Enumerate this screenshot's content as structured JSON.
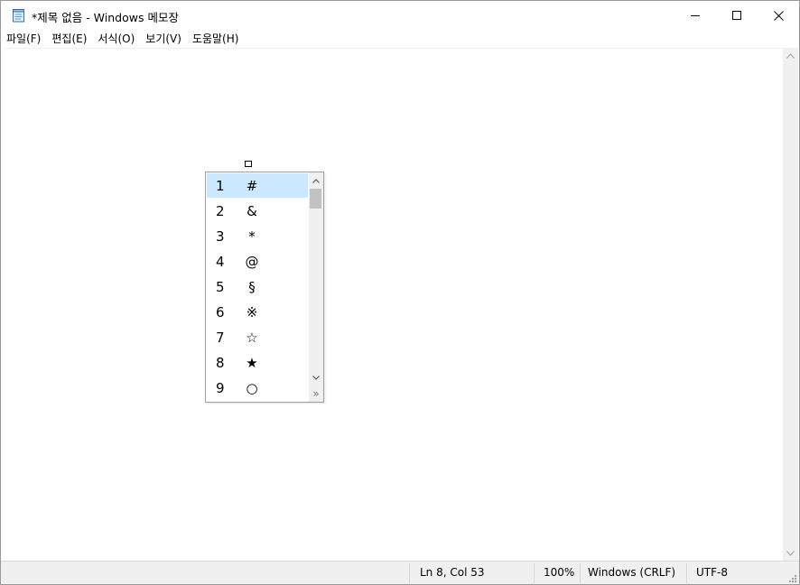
{
  "window": {
    "title": "*제목 없음 - Windows 메모장"
  },
  "icons": {
    "app": "notepad-icon",
    "minimize": "minimize-icon",
    "maximize": "maximize-icon",
    "close": "close-icon"
  },
  "menu": [
    {
      "label": "파일(F)"
    },
    {
      "label": "편집(E)"
    },
    {
      "label": "서식(O)"
    },
    {
      "label": "보기(V)"
    },
    {
      "label": "도움말(H)"
    }
  ],
  "candidates": {
    "selected_index": 0,
    "items": [
      {
        "num": "1",
        "symbol": "#"
      },
      {
        "num": "2",
        "symbol": "&"
      },
      {
        "num": "3",
        "symbol": "*"
      },
      {
        "num": "4",
        "symbol": "@"
      },
      {
        "num": "5",
        "symbol": "§"
      },
      {
        "num": "6",
        "symbol": "※"
      },
      {
        "num": "7",
        "symbol": "☆"
      },
      {
        "num": "8",
        "symbol": "★"
      },
      {
        "num": "9",
        "symbol": "○"
      }
    ],
    "expand_label": "»"
  },
  "status": {
    "position": "Ln 8, Col 53",
    "zoom": "100%",
    "line_ending": "Windows (CRLF)",
    "encoding": "UTF-8"
  },
  "colors": {
    "selection": "#cce8ff",
    "chrome": "#f0f0f0"
  }
}
